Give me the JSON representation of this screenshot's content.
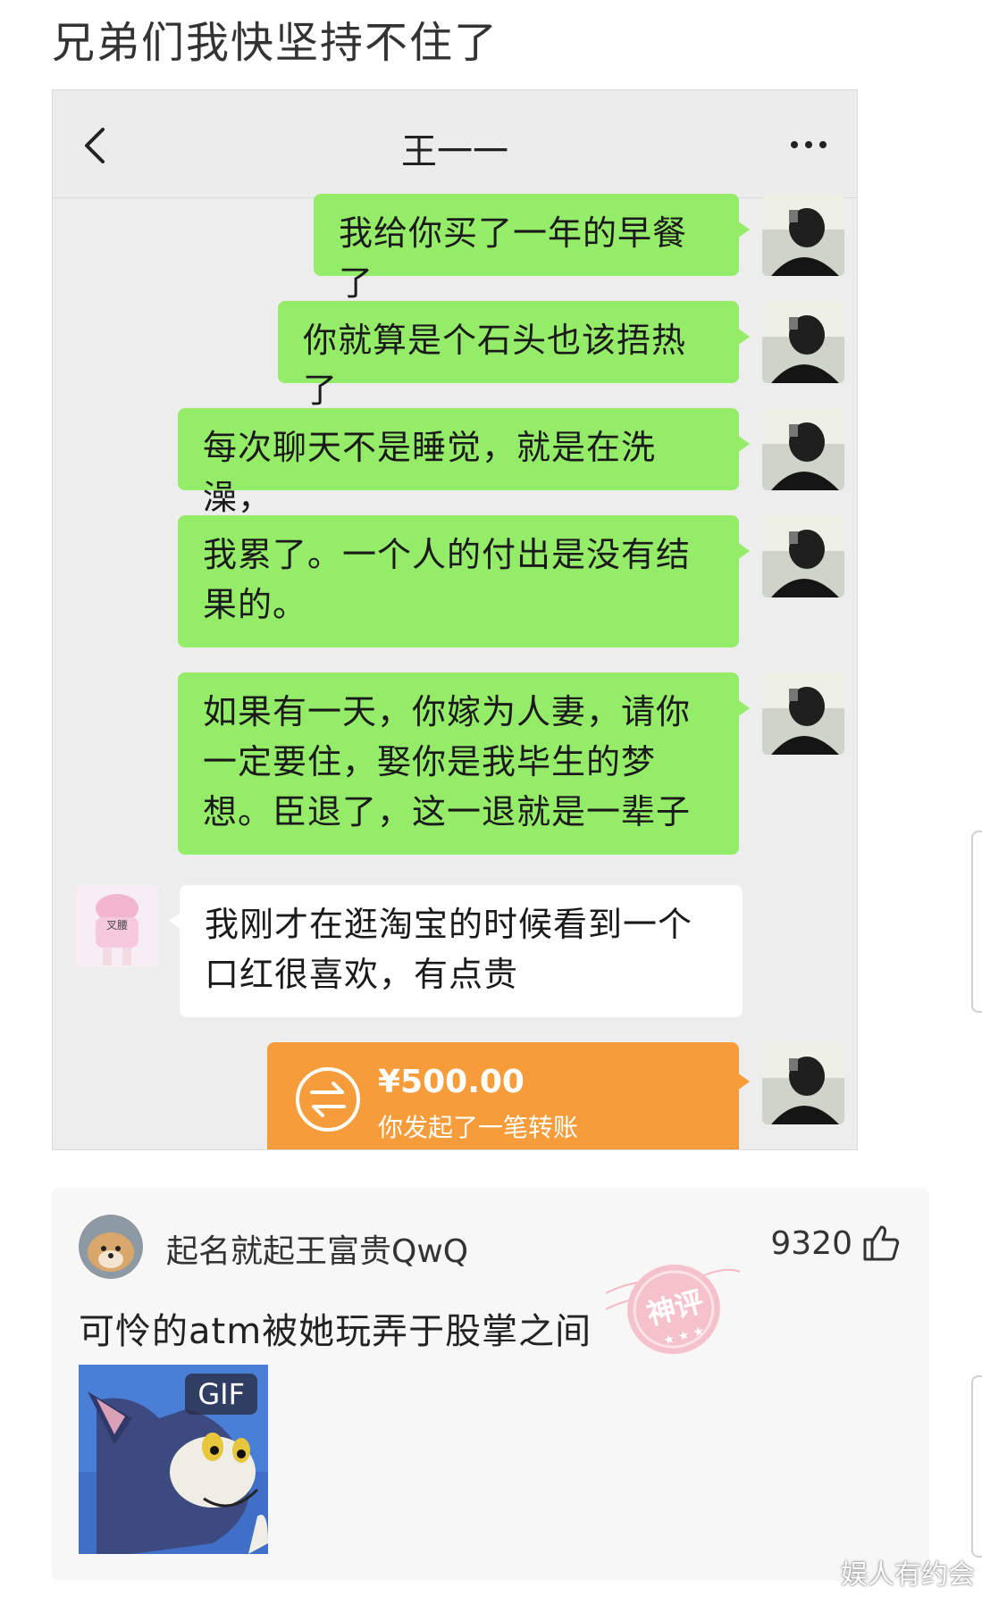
{
  "post": {
    "title": "兄弟们我快坚持不住了"
  },
  "chat": {
    "contact_name": "王一一",
    "messages": [
      {
        "side": "me",
        "text": "我给你买了一年的早餐了"
      },
      {
        "side": "me",
        "text": "你就算是个石头也该捂热了"
      },
      {
        "side": "me",
        "text": "每次聊天不是睡觉，就是在洗澡，"
      },
      {
        "side": "me",
        "text": "我累了。一个人的付出是没有结果的。"
      },
      {
        "side": "me",
        "text": "如果有一天，你嫁为人妻，请你一定要住，娶你是我毕生的梦想。臣退了，这一退就是一辈子"
      },
      {
        "side": "other",
        "text": "我刚才在逛淘宝的时候看到一个口红很喜欢，有点贵",
        "avatar_label": "叉腰"
      }
    ],
    "transfer": {
      "amount": "¥500.00",
      "desc": "你发起了一笔转账"
    }
  },
  "comment": {
    "username": "起名就起王富贵QwQ",
    "likes": "9320",
    "text": "可怜的atm被她玩弄于股掌之间",
    "gif_badge": "GIF",
    "stamp_text": "神评"
  },
  "watermark": "娱人有约会",
  "colors": {
    "green_bubble": "#95ec69",
    "transfer_orange": "#f79c3a",
    "chat_bg": "#ededed"
  }
}
